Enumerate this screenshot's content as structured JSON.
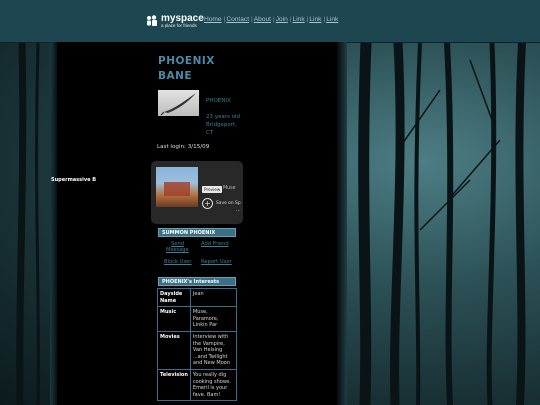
{
  "header": {
    "logo_main": "myspace",
    "logo_tagline": "a place for friends",
    "nav": [
      "Home",
      "Contact",
      "About",
      "Join",
      "Link",
      "Link",
      "Link"
    ]
  },
  "profile": {
    "name_line1": "PHOENIX",
    "name_line2": "BANE",
    "nickname": "PHOENIX",
    "age": "23 years old",
    "city": "Bridgeport,",
    "state": "CT",
    "last_login": "Last login: 3/15/09"
  },
  "player": {
    "track_title": "Supermassive B",
    "preview_label": "Preview",
    "artist": "Muse",
    "save_label": "Save on Sp",
    "more": "..."
  },
  "contact": {
    "heading": "SUMMON PHOENIX",
    "send_message_1": "Send",
    "send_message_2": "Message",
    "add_friend": "Add Friend",
    "block_user": "Block User",
    "report_user": "Report User"
  },
  "interests": {
    "heading": "PHOENIX's Interests",
    "rows": [
      {
        "label": "Dayside Name",
        "value": "Jean"
      },
      {
        "label": "Music",
        "value": "Muse, Paramore, Linkin Par"
      },
      {
        "label": "Movies",
        "value": "Interview with the Vampire, Van Helsing ...and Twilight and New Moon"
      },
      {
        "label": "Television",
        "value": "You really dig cooking shows. Emeril is your fave. Bam!"
      }
    ]
  },
  "colors": {
    "header_bg": "#1d4650",
    "accent_blue": "#3f7f96",
    "panel_bg": "#000000"
  }
}
